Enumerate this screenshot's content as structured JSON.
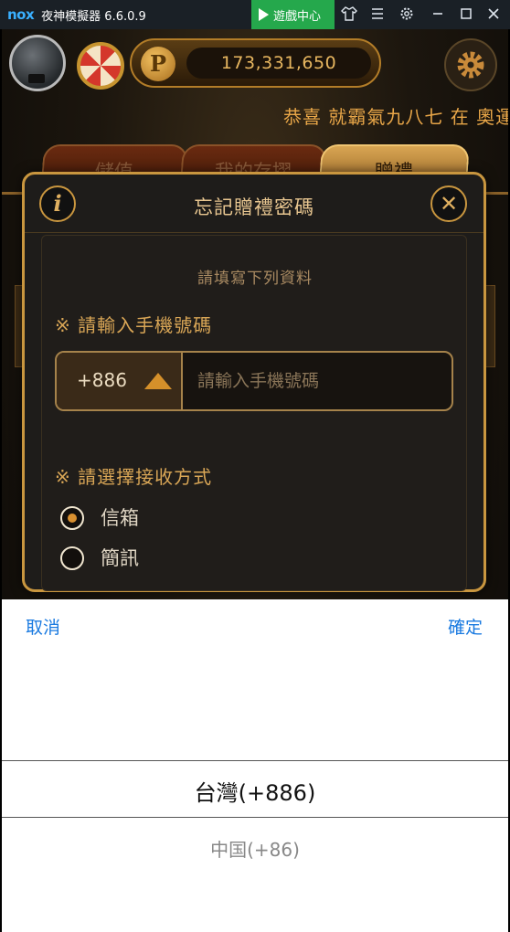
{
  "titlebar": {
    "logo": "nox",
    "title": "夜神模擬器 6.6.0.9",
    "game_center": "遊戲中心",
    "icons": [
      "shirt-icon",
      "menu-icon",
      "settings-icon",
      "minimize-icon",
      "maximize-icon",
      "close-icon"
    ]
  },
  "header": {
    "coin_symbol": "P",
    "coins": "173,331,650",
    "marquee": "恭喜 就霸氣九八七 在 奧運會"
  },
  "tabs": [
    {
      "label": "儲值",
      "active": false
    },
    {
      "label": "我的存摺",
      "active": false
    },
    {
      "label": "贈禮",
      "active": true
    }
  ],
  "modal": {
    "info": "i",
    "close": "✕",
    "title": "忘記贈禮密碼",
    "subtitle": "請填寫下列資料",
    "phone_label": "※ 請輸入手機號碼",
    "country_code": "+886",
    "phone_placeholder": "請輸入手機號碼",
    "method_label": "※ 請選擇接收方式",
    "options": [
      {
        "label": "信箱",
        "checked": true
      },
      {
        "label": "簡訊",
        "checked": false
      }
    ]
  },
  "picker": {
    "cancel": "取消",
    "confirm": "確定",
    "selected": "台灣(+886)",
    "options": [
      "中国(+86)"
    ]
  },
  "colors": {
    "gold": "#c9963f",
    "picker_button": "#1a7ae0",
    "game_center_bg": "#25a84c"
  }
}
